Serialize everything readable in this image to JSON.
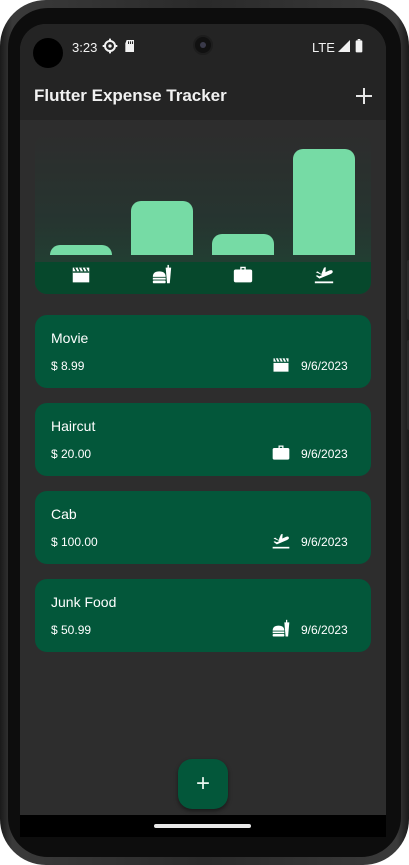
{
  "status_bar": {
    "time": "3:23",
    "network": "LTE"
  },
  "app_bar": {
    "title": "Flutter Expense Tracker"
  },
  "chart": {
    "bar_color": "#76dba5",
    "categories": [
      "leisure-icon",
      "food-icon",
      "work-icon",
      "travel-icon"
    ],
    "relative_heights": [
      0.09,
      0.51,
      0.2,
      1.0
    ]
  },
  "expenses": [
    {
      "title": "Movie",
      "amount": "$ 8.99",
      "date": "9/6/2023",
      "category_icon": "movie-clapper-icon"
    },
    {
      "title": "Haircut",
      "amount": "$ 20.00",
      "date": "9/6/2023",
      "category_icon": "briefcase-icon"
    },
    {
      "title": "Cab",
      "amount": "$ 100.00",
      "date": "9/6/2023",
      "category_icon": "flight-takeoff-icon"
    },
    {
      "title": "Junk Food",
      "amount": "$ 50.99",
      "date": "9/6/2023",
      "category_icon": "fastfood-icon"
    }
  ],
  "fab": {
    "label": "+"
  },
  "colors": {
    "card": "#03573a",
    "bar": "#76dba5",
    "icon_strip": "#06482c",
    "background": "#2d2d2d"
  }
}
